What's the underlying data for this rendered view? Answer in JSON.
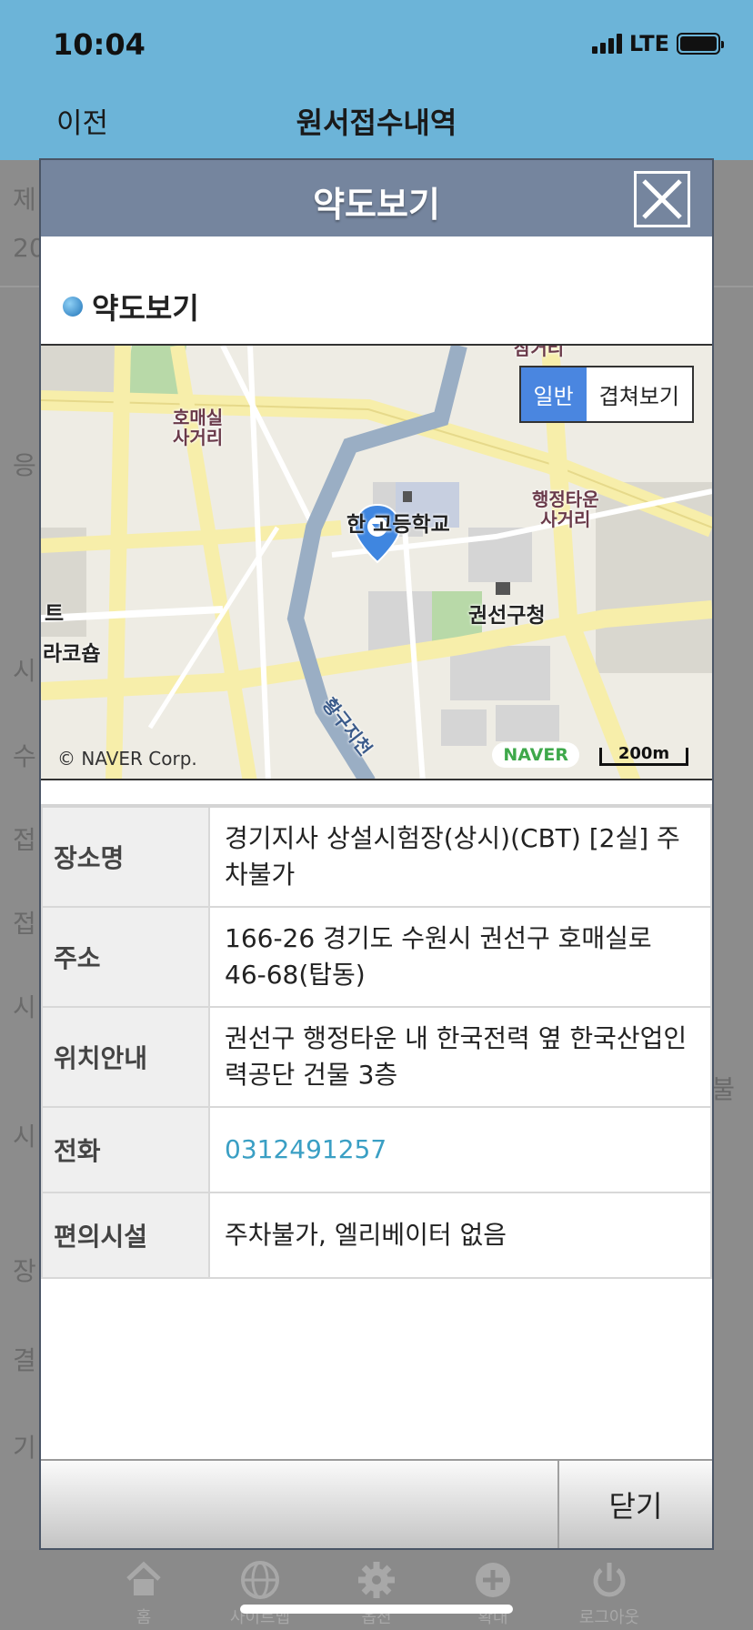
{
  "status": {
    "time": "10:04",
    "network": "LTE"
  },
  "header": {
    "back_label": "이전",
    "title": "원서접수내역"
  },
  "background_page": {
    "labels": [
      "제",
      "20",
      "응",
      "시",
      "수",
      "접",
      "접",
      "시",
      "시",
      "장",
      "결",
      "기"
    ],
    "right_text": "불"
  },
  "modal": {
    "title": "약도보기",
    "section_title": "약도보기",
    "map": {
      "toggle": [
        "일반",
        "겹쳐보기"
      ],
      "labels": {
        "top": "삼거리",
        "homaesil": "호매실\n사거리",
        "school": "한 고등학교",
        "haengjeong": "행정타운\n사거리",
        "gwonseon": "권선구청",
        "left1": "트",
        "left2": "라코숍",
        "stream": "황구지천"
      },
      "copyright": "© NAVER Corp.",
      "brand": "NAVER",
      "scale": "200m"
    },
    "rows": [
      {
        "key": "장소명",
        "value": "경기지사 상설시험장(상시)(CBT) [2실] 주차불가"
      },
      {
        "key": "주소",
        "value": "166-26 경기도 수원시 권선구 호매실로 46-68(탑동)"
      },
      {
        "key": "위치안내",
        "value": "권선구 행정타운 내 한국전력 옆 한국산업인력공단 건물 3층"
      },
      {
        "key": "전화",
        "value": "0312491257"
      },
      {
        "key": "편의시설",
        "value": "주차불가, 엘리베이터 없음"
      }
    ],
    "close_label": "닫기"
  },
  "tabbar": {
    "items": [
      {
        "label": "홈",
        "icon": "home-icon"
      },
      {
        "label": "사이트맵",
        "icon": "globe-icon"
      },
      {
        "label": "옵션",
        "icon": "gear-icon"
      },
      {
        "label": "확대",
        "icon": "plus-icon"
      },
      {
        "label": "로그아웃",
        "icon": "power-icon"
      }
    ]
  },
  "colors": {
    "header_bg": "#6cb4d8",
    "modal_header": "#75859e",
    "toggle_active": "#4a86e0",
    "phone_link": "#3a9fc4"
  }
}
